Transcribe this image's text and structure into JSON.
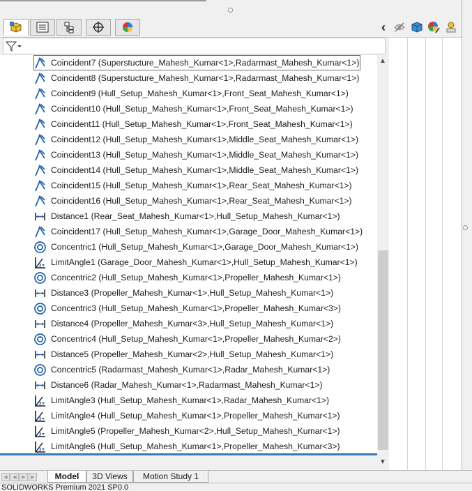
{
  "panel_tabs": [
    {
      "name": "feature-manager-tab-icon",
      "active": true
    },
    {
      "name": "property-manager-tab-icon",
      "active": false
    },
    {
      "name": "configuration-manager-tab-icon",
      "active": false
    },
    {
      "name": "dimxpert-manager-tab-icon",
      "active": false
    },
    {
      "name": "display-manager-tab-icon",
      "active": false
    }
  ],
  "right_tools": {
    "collapse_glyph": "‹"
  },
  "tree": {
    "items": [
      {
        "icon": "coincident",
        "label": "Coincident7 (Superstucture_Mahesh_Kumar<1>,Radarmast_Mahesh_Kumar<1>)"
      },
      {
        "icon": "coincident",
        "label": "Coincident8 (Superstucture_Mahesh_Kumar<1>,Radarmast_Mahesh_Kumar<1>)"
      },
      {
        "icon": "coincident",
        "label": "Coincident9 (Hull_Setup_Mahesh_Kumar<1>,Front_Seat_Mahesh_Kumar<1>)"
      },
      {
        "icon": "coincident",
        "label": "Coincident10 (Hull_Setup_Mahesh_Kumar<1>,Front_Seat_Mahesh_Kumar<1>)"
      },
      {
        "icon": "coincident",
        "label": "Coincident11 (Hull_Setup_Mahesh_Kumar<1>,Front_Seat_Mahesh_Kumar<1>)"
      },
      {
        "icon": "coincident",
        "label": "Coincident12 (Hull_Setup_Mahesh_Kumar<1>,Middle_Seat_Mahesh_Kumar<1>)"
      },
      {
        "icon": "coincident",
        "label": "Coincident13 (Hull_Setup_Mahesh_Kumar<1>,Middle_Seat_Mahesh_Kumar<1>)"
      },
      {
        "icon": "coincident",
        "label": "Coincident14 (Hull_Setup_Mahesh_Kumar<1>,Middle_Seat_Mahesh_Kumar<1>)"
      },
      {
        "icon": "coincident",
        "label": "Coincident15 (Hull_Setup_Mahesh_Kumar<1>,Rear_Seat_Mahesh_Kumar<1>)"
      },
      {
        "icon": "coincident",
        "label": "Coincident16 (Hull_Setup_Mahesh_Kumar<1>,Rear_Seat_Mahesh_Kumar<1>)"
      },
      {
        "icon": "distance",
        "label": "Distance1 (Rear_Seat_Mahesh_Kumar<1>,Hull_Setup_Mahesh_Kumar<1>)"
      },
      {
        "icon": "coincident",
        "label": "Coincident17 (Hull_Setup_Mahesh_Kumar<1>,Garage_Door_Mahesh_Kumar<1>)"
      },
      {
        "icon": "concentric",
        "label": "Concentric1 (Hull_Setup_Mahesh_Kumar<1>,Garage_Door_Mahesh_Kumar<1>)"
      },
      {
        "icon": "limitangle",
        "label": "LimitAngle1 (Garage_Door_Mahesh_Kumar<1>,Hull_Setup_Mahesh_Kumar<1>)"
      },
      {
        "icon": "concentric",
        "label": "Concentric2 (Hull_Setup_Mahesh_Kumar<1>,Propeller_Mahesh_Kumar<1>)"
      },
      {
        "icon": "distance",
        "label": "Distance3 (Propeller_Mahesh_Kumar<1>,Hull_Setup_Mahesh_Kumar<1>)"
      },
      {
        "icon": "concentric",
        "label": "Concentric3 (Hull_Setup_Mahesh_Kumar<1>,Propeller_Mahesh_Kumar<3>)"
      },
      {
        "icon": "distance",
        "label": "Distance4 (Propeller_Mahesh_Kumar<3>,Hull_Setup_Mahesh_Kumar<1>)"
      },
      {
        "icon": "concentric",
        "label": "Concentric4 (Hull_Setup_Mahesh_Kumar<1>,Propeller_Mahesh_Kumar<2>)"
      },
      {
        "icon": "distance",
        "label": "Distance5 (Propeller_Mahesh_Kumar<2>,Hull_Setup_Mahesh_Kumar<1>)"
      },
      {
        "icon": "concentric",
        "label": "Concentric5 (Radarmast_Mahesh_Kumar<1>,Radar_Mahesh_Kumar<1>)"
      },
      {
        "icon": "distance",
        "label": "Distance6 (Radar_Mahesh_Kumar<1>,Radarmast_Mahesh_Kumar<1>)"
      },
      {
        "icon": "limitangle",
        "label": "LimitAngle3 (Hull_Setup_Mahesh_Kumar<1>,Radar_Mahesh_Kumar<1>)"
      },
      {
        "icon": "limitangle",
        "label": "LimitAngle4 (Hull_Setup_Mahesh_Kumar<1>,Propeller_Mahesh_Kumar<1>)"
      },
      {
        "icon": "limitangle",
        "label": "LimitAngle5 (Propeller_Mahesh_Kumar<2>,Hull_Setup_Mahesh_Kumar<1>)"
      },
      {
        "icon": "limitangle",
        "label": "LimitAngle6 (Hull_Setup_Mahesh_Kumar<1>,Propeller_Mahesh_Kumar<3>)"
      }
    ]
  },
  "bottom_tabs": {
    "model": "Model",
    "views3d": "3D Views",
    "motion": "Motion Study 1"
  },
  "status": {
    "text": "SOLIDWORKS Premium 2021 SP0.0"
  },
  "colors": {
    "accent": "#1f5fa6",
    "selection_line": "#3b78b4"
  }
}
